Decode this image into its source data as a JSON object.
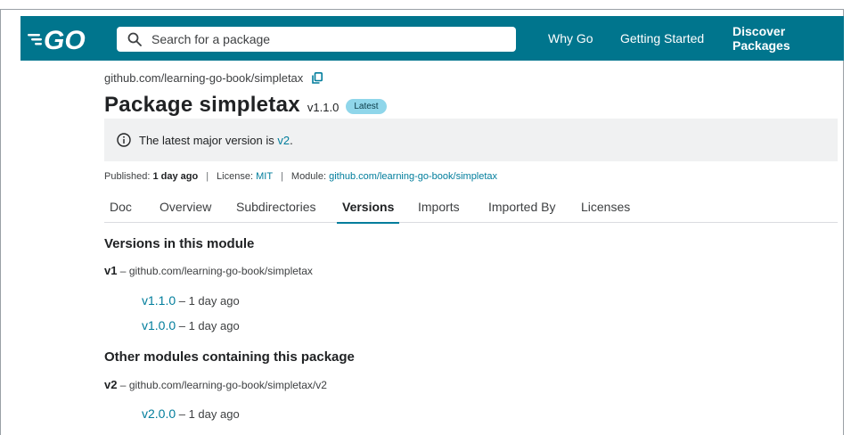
{
  "colors": {
    "header_bg": "#00758d",
    "link": "#007d9c",
    "badge_bg": "#8fd6ea",
    "notice_bg": "#f0f1f2"
  },
  "header": {
    "logo": "GO",
    "search": {
      "placeholder": "Search for a package",
      "icon": "search-icon"
    },
    "nav": {
      "why_go": "Why Go",
      "getting_started": "Getting Started",
      "discover_packages": "Discover Packages"
    }
  },
  "breadcrumb": {
    "path": "github.com/learning-go-book/simpletax",
    "copy_icon": "copy-icon"
  },
  "package": {
    "title": "Package simpletax",
    "version": "v1.1.0",
    "badge": "Latest"
  },
  "notice": {
    "text": "The latest major version is ",
    "link": "v2",
    "suffix": "."
  },
  "meta": {
    "published_label": "Published:",
    "published_value": "1 day ago",
    "sep": "|",
    "license_label": "License:",
    "license_value": "MIT",
    "module_label": "Module:",
    "module_value": "github.com/learning-go-book/simpletax"
  },
  "tabs": [
    "Doc",
    "Overview",
    "Subdirectories",
    "Versions",
    "Imports",
    "Imported By",
    "Licenses"
  ],
  "active_tab": "Versions",
  "versions": {
    "heading": "Versions in this module",
    "major": "v1",
    "dash": " – ",
    "module": "github.com/learning-go-book/simpletax",
    "items": [
      {
        "version": "v1.1.0",
        "age": " – 1 day ago"
      },
      {
        "version": "v1.0.0",
        "age": " – 1 day ago"
      }
    ]
  },
  "other": {
    "heading": "Other modules containing this package",
    "major": "v2",
    "dash": " – ",
    "module": "github.com/learning-go-book/simpletax/v2",
    "items": [
      {
        "version": "v2.0.0",
        "age": " – 1 day ago"
      }
    ]
  }
}
